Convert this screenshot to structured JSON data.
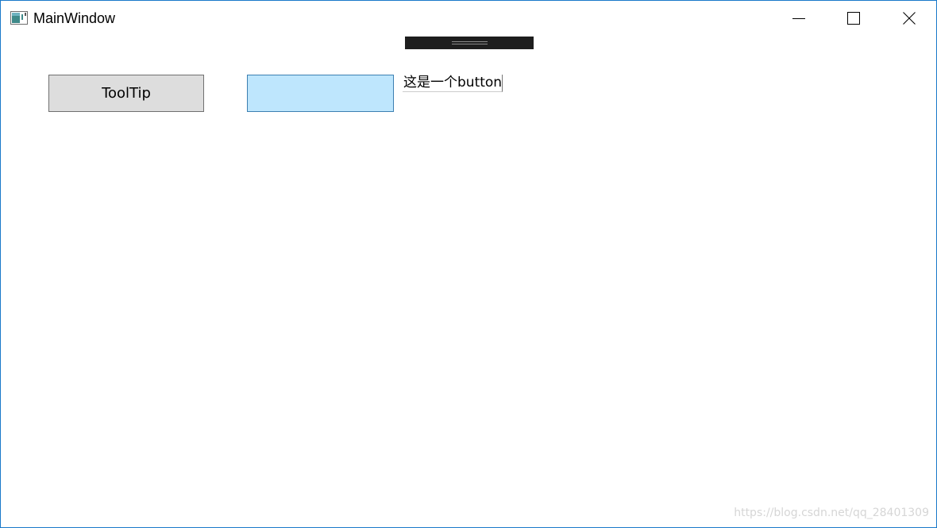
{
  "window": {
    "title": "MainWindow",
    "border_color": "#1979ca",
    "icon": "wpf-window-icon",
    "caption_buttons": [
      {
        "name": "minimize",
        "icon": "minimize-icon"
      },
      {
        "name": "maximize",
        "icon": "maximize-icon"
      },
      {
        "name": "close",
        "icon": "close-icon"
      }
    ]
  },
  "debug_toolbar": {
    "icon": "grip-handle-icon",
    "color": "#1e1e1e"
  },
  "content": {
    "tooltip_button": {
      "label": "ToolTip",
      "background": "#dddddd"
    },
    "hover_button": {
      "label": "",
      "background": "#bee6fd",
      "border": "#3c7fb1"
    },
    "tooltip_popup": {
      "text": "这是一个button"
    }
  },
  "watermark": {
    "text": "https://blog.csdn.net/qq_28401309"
  }
}
